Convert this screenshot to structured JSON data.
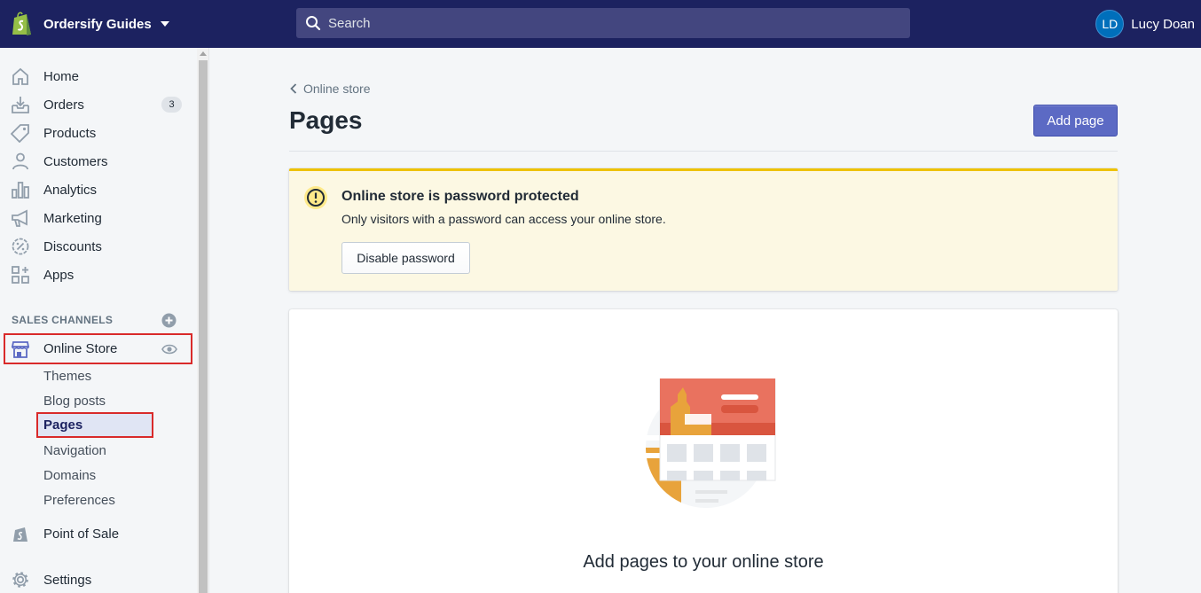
{
  "topbar": {
    "store_name": "Ordersify Guides",
    "search_placeholder": "Search",
    "user_initials": "LD",
    "user_name": "Lucy Doan"
  },
  "sidebar": {
    "items": [
      {
        "label": "Home",
        "icon": "home-icon"
      },
      {
        "label": "Orders",
        "icon": "orders-icon",
        "badge": "3"
      },
      {
        "label": "Products",
        "icon": "tag-icon"
      },
      {
        "label": "Customers",
        "icon": "person-icon"
      },
      {
        "label": "Analytics",
        "icon": "bar-chart-icon"
      },
      {
        "label": "Marketing",
        "icon": "megaphone-icon"
      },
      {
        "label": "Discounts",
        "icon": "discount-icon"
      },
      {
        "label": "Apps",
        "icon": "apps-icon"
      }
    ],
    "sales_channels_title": "SALES CHANNELS",
    "online_store": {
      "label": "Online Store",
      "subitems": [
        "Themes",
        "Blog posts",
        "Pages",
        "Navigation",
        "Domains",
        "Preferences"
      ],
      "active_subitem": "Pages"
    },
    "point_of_sale": "Point of Sale",
    "settings": "Settings"
  },
  "main": {
    "breadcrumb": "Online store",
    "title": "Pages",
    "add_page_label": "Add page",
    "banner": {
      "title": "Online store is password protected",
      "text": "Only visitors with a password can access your online store.",
      "button": "Disable password"
    },
    "empty_state": {
      "title": "Add pages to your online store"
    }
  },
  "colors": {
    "topbar_bg": "#1c2260",
    "primary": "#5c6ac4",
    "highlight_border": "#d92a2a",
    "warning": "#eec200"
  }
}
